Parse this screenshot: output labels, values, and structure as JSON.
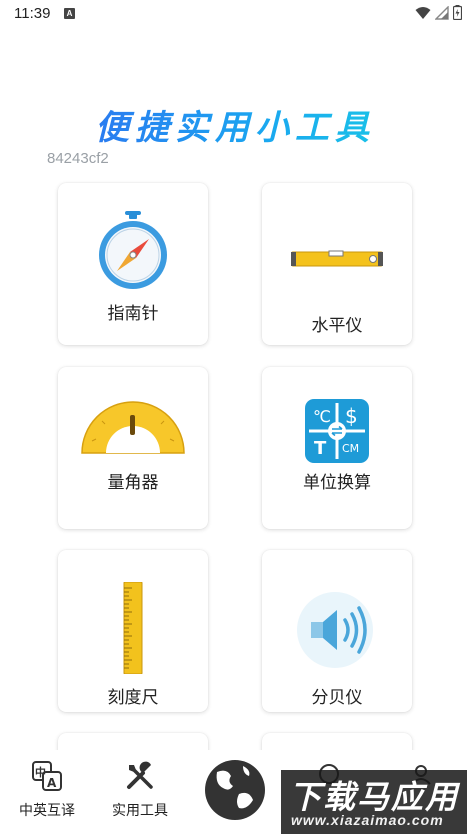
{
  "status": {
    "time": "11:39",
    "notification_glyph": "A"
  },
  "title": "便捷实用小工具",
  "build_id": "84243cf2",
  "tools": [
    {
      "label": "指南针",
      "icon": "compass-icon"
    },
    {
      "label": "水平仪",
      "icon": "spirit-level-icon"
    },
    {
      "label": "量角器",
      "icon": "protractor-icon"
    },
    {
      "label": "单位换算",
      "icon": "unit-conversion-icon"
    },
    {
      "label": "刻度尺",
      "icon": "ruler-icon"
    },
    {
      "label": "分贝仪",
      "icon": "speaker-icon"
    }
  ],
  "nav": [
    {
      "label": "中英互译",
      "icon": "translate-icon"
    },
    {
      "label": "实用工具",
      "icon": "tools-icon"
    },
    {
      "label": "",
      "icon": "globe-icon"
    },
    {
      "label": "",
      "icon": "nav-icon-4"
    },
    {
      "label": "",
      "icon": "nav-icon-5"
    }
  ],
  "watermark": {
    "big": "下载马应用",
    "small": "www.xiazaimao.com"
  },
  "colors": {
    "accent": "#1aa7f0",
    "gold": "#f5c518",
    "teal": "#1e9bd7"
  }
}
